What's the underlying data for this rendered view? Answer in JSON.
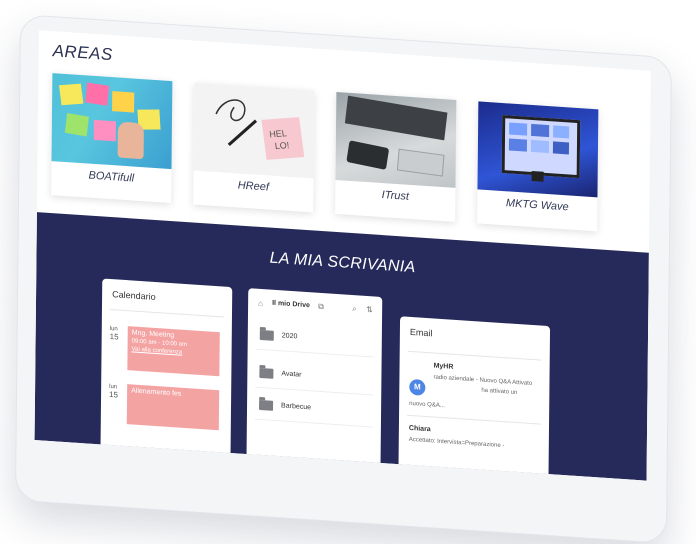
{
  "areas": {
    "title": "AREAS",
    "cards": [
      {
        "label": "BOATifull"
      },
      {
        "label": "HReef"
      },
      {
        "label": "ITrust"
      },
      {
        "label": "MKTG Wave"
      }
    ]
  },
  "desk": {
    "title": "LA MIA SCRIVANIA",
    "calendar": {
      "title": "Calendario",
      "days": [
        {
          "weekday": "lun",
          "date": "15"
        },
        {
          "weekday": "lun",
          "date": "15"
        }
      ],
      "events": [
        {
          "title": "Mng. Meeting",
          "time": "09:00 am - 10:00 am",
          "link": "Vai alla conferenza"
        },
        {
          "title": "Allenamento fes"
        }
      ]
    },
    "drive": {
      "title": "Il mio Drive",
      "folders": [
        "2020",
        "Avatar",
        "Barbecue"
      ]
    },
    "email": {
      "title": "Email",
      "messages": [
        {
          "avatar": "M",
          "sender": "MyHR",
          "preview1": "radio aziendale - Nuovo Q&A Attivato",
          "preview2": "ha attivato un",
          "preview3": "nuovo Q&A..."
        },
        {
          "sender": "Chiara",
          "preview1": "Accettato: Intervista=Preparazione -"
        }
      ]
    }
  }
}
